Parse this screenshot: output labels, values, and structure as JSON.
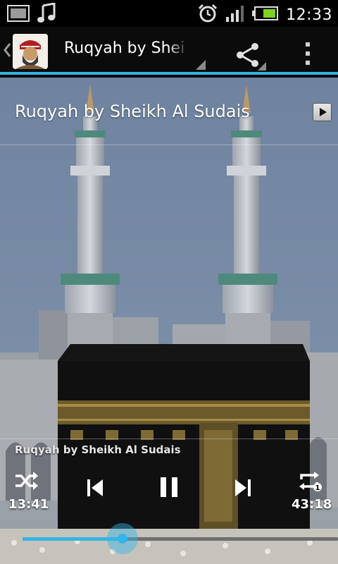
{
  "status_bar": {
    "time": "12:33",
    "icons": [
      "picture-icon",
      "music-note-icon",
      "alarm-clock-icon",
      "signal-icon",
      "battery-icon"
    ]
  },
  "action_bar": {
    "title": "Ruqyah by Sheikh Al Sudais",
    "icons": [
      "back-chevron-icon",
      "app-icon",
      "share-icon",
      "overflow-menu-icon"
    ]
  },
  "track": {
    "title": "Ruqyah by Sheikh Al Sudais"
  },
  "player": {
    "now_playing": "Ruqyah by Sheikh Al Sudais",
    "elapsed": "13:41",
    "duration": "43:18",
    "progress": 0.316,
    "repeat_badge": "1"
  },
  "colors": {
    "accent": "#33b5e5",
    "status_bar_bg": "#000000",
    "action_bar_bg": "#0b0b0b"
  }
}
